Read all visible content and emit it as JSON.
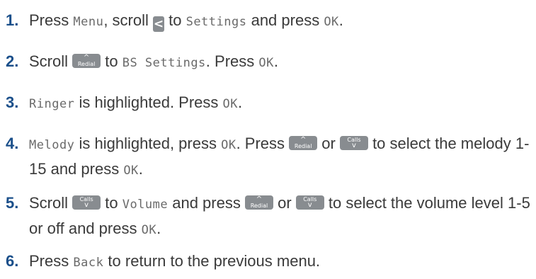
{
  "steps": [
    {
      "num": "1.",
      "p1": "Press ",
      "lcd1": "Menu",
      "p2": ", scroll ",
      "key1": "<",
      "p3": " to ",
      "lcd2": "Settings",
      "p4": " and press ",
      "lcd3": "OK",
      "p5": "."
    },
    {
      "num": "2.",
      "p1": "Scroll ",
      "key1_arrow": "^",
      "key1_label": "Redial",
      "p2": " to ",
      "lcd1": "BS Settings",
      "p3": ". Press ",
      "lcd2": "OK",
      "p4": "."
    },
    {
      "num": "3.",
      "lcd1": "Ringer",
      "p1": " is highlighted. Press ",
      "lcd2": "OK",
      "p2": "."
    },
    {
      "num": "4.",
      "lcd1": "Melody",
      "p1": " is highlighted, press ",
      "lcd2": "OK",
      "p2": ". Press ",
      "key1_arrow": "^",
      "key1_label": "Redial",
      "p3": " or ",
      "key2_label": "Calls",
      "key2_arrow": "v",
      "p4": " to select the melody 1-15 and press ",
      "lcd3": "OK",
      "p5": "."
    },
    {
      "num": "5.",
      "p1": "Scroll ",
      "key1_label": "Calls",
      "key1_arrow": "v",
      "p2": " to ",
      "lcd1": "Volume",
      "p3": " and press ",
      "key2_arrow": "^",
      "key2_label": "Redial",
      "p4": " or ",
      "key3_label": "Calls",
      "key3_arrow": "v",
      "p5": " to select the volume level 1-5 or off and press ",
      "lcd2": "OK",
      "p6": "."
    },
    {
      "num": "6.",
      "p1": "Press ",
      "lcd1": "Back",
      "p2": " to return to the previous menu."
    }
  ]
}
